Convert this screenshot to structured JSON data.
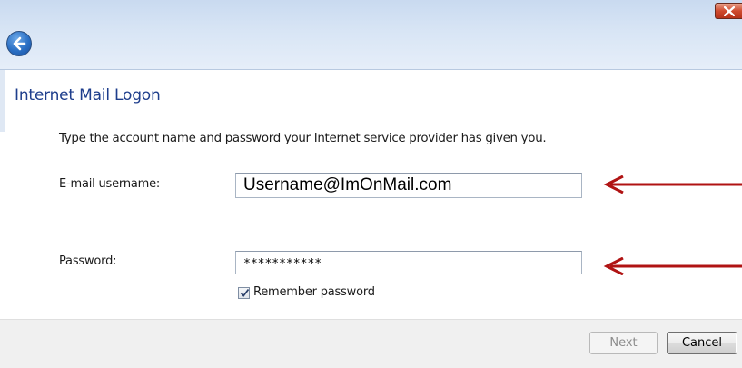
{
  "window": {
    "close_icon": "close-icon",
    "back_icon": "back-arrow-icon"
  },
  "page": {
    "title": "Internet Mail Logon",
    "instruction": "Type the account name and password your Internet service provider has given you."
  },
  "form": {
    "email_label": "E-mail username:",
    "email_value": "Username@ImOnMail.com",
    "password_label": "Password:",
    "password_value": "***********",
    "remember_label": "Remember password",
    "remember_checked": true
  },
  "buttons": {
    "next_label": "Next",
    "next_enabled": false,
    "cancel_label": "Cancel"
  },
  "annotations": {
    "arrow_color": "#b01313",
    "arrows": [
      "arrow-pointing-to-email-field",
      "arrow-pointing-to-password-field"
    ]
  },
  "colors": {
    "title_blue": "#1e3e8c",
    "close_red": "#cf4a2e",
    "titlebar_blue": "#d8e5f5"
  }
}
